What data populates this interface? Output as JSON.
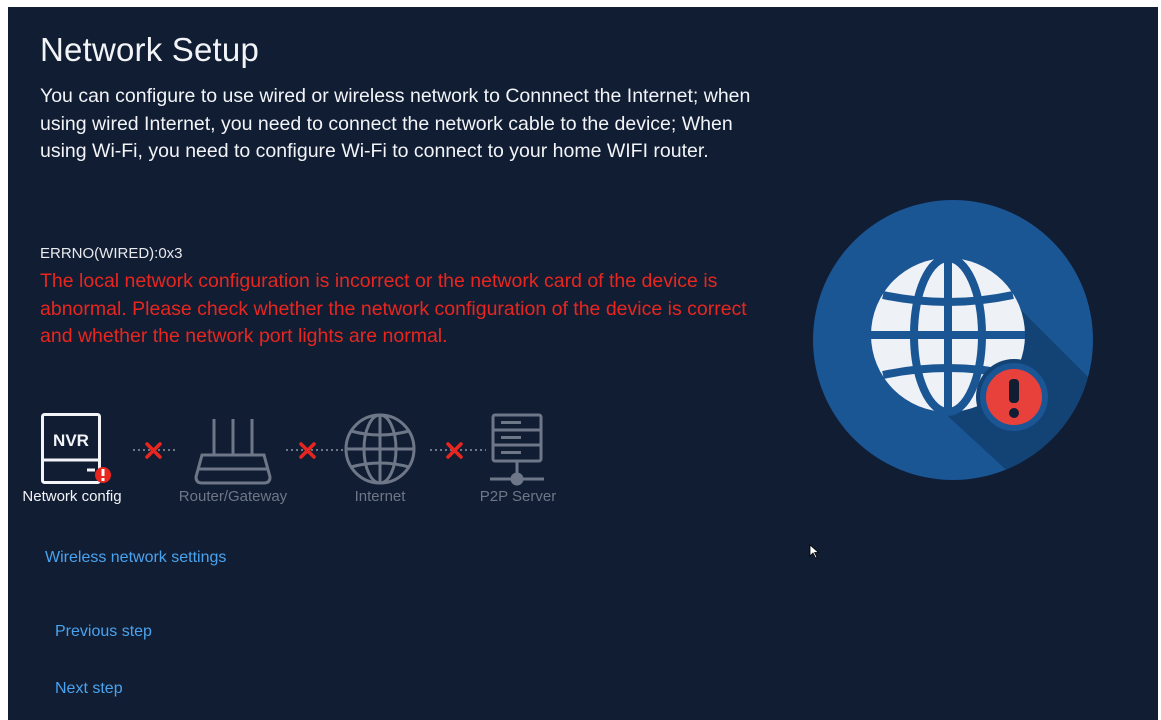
{
  "page": {
    "title": "Network Setup",
    "description": "You can configure to use wired or wireless network to Connnect the Internet; when using wired Internet, you need to connect the network cable to the device; When using Wi-Fi, you need to configure Wi-Fi to connect to your home WIFI router.",
    "error_code": "ERRNO(WIRED):0x3",
    "error_message": "The local network configuration is incorrect or the network card of the device is abnormal. Please check whether the network configuration of the device is correct and whether the network port lights are normal."
  },
  "diagram": {
    "nvr_text": "NVR",
    "nodes": [
      {
        "label": "Network config",
        "icon": "nvr-icon",
        "status": "error"
      },
      {
        "label": "Router/Gateway",
        "icon": "router-icon",
        "status": "disconnected"
      },
      {
        "label": "Internet",
        "icon": "globe-icon",
        "status": "disconnected"
      },
      {
        "label": "P2P Server",
        "icon": "server-icon",
        "status": "disconnected"
      }
    ],
    "link_status": "failed"
  },
  "actions": {
    "wireless_settings": "Wireless network settings",
    "previous_step": "Previous step",
    "next_step": "Next step"
  },
  "colors": {
    "background": "#111d33",
    "error_text": "#e8261f",
    "link_text": "#4aa3ee",
    "globe_circle": "#1a5594",
    "alert_badge": "#e8413c"
  },
  "status_icon": "globe-warning-icon"
}
